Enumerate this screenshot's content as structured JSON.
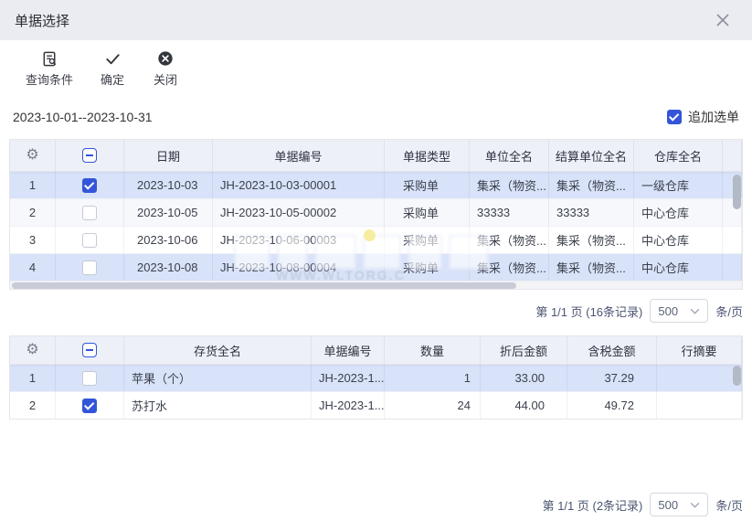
{
  "dialog": {
    "title": "单据选择"
  },
  "toolbar": {
    "query_label": "查询条件",
    "confirm_label": "确定",
    "close_label": "关闭"
  },
  "filter": {
    "date_range": "2023-10-01--2023-10-31",
    "append_label": "追加选单",
    "append_checked": true
  },
  "colors": {
    "accent_blue": "#3355d8",
    "selected_row": "#d8e2f8",
    "header_bg": "#eef0f7",
    "titlebar_bg": "#ebecf1",
    "marker_yellow": "#f6eda0"
  },
  "doc_table": {
    "headers": {
      "date": "日期",
      "doc_no": "单据编号",
      "doc_type": "单据类型",
      "unit": "单位全名",
      "settle_unit": "结算单位全名",
      "warehouse": "仓库全名"
    },
    "header_check": {
      "state": "indeterminate"
    },
    "rows": [
      {
        "num": "1",
        "checked": true,
        "date": "2023-10-03",
        "doc_no": "JH-2023-10-03-00001",
        "doc_type": "采购单",
        "unit": "集采（物资...",
        "settle_unit": "集采（物资...",
        "warehouse": "一级仓库"
      },
      {
        "num": "2",
        "checked": false,
        "date": "2023-10-05",
        "doc_no": "JH-2023-10-05-00002",
        "doc_type": "采购单",
        "unit": "33333",
        "settle_unit": "33333",
        "warehouse": "中心仓库"
      },
      {
        "num": "3",
        "checked": false,
        "date": "2023-10-06",
        "doc_no": "JH-2023-10-06-00003",
        "doc_type": "采购单",
        "unit": "集采（物资...",
        "settle_unit": "集采（物资...",
        "warehouse": "中心仓库"
      },
      {
        "num": "4",
        "checked": false,
        "date": "2023-10-08",
        "doc_no": "JH-2023-10-08-00004",
        "doc_type": "采购单",
        "unit": "集采（物资...",
        "settle_unit": "集采（物资...",
        "warehouse": "中心仓库"
      }
    ]
  },
  "doc_pagination": {
    "page_info": "第 1/1 页 (16条记录)",
    "page_size": "500",
    "unit_label": "条/页"
  },
  "item_table": {
    "headers": {
      "item_name": "存货全名",
      "doc_no": "单据编号",
      "qty": "数量",
      "discount_amount": "折后金额",
      "tax_amount": "含税金额",
      "row_summary": "行摘要"
    },
    "header_check": {
      "state": "indeterminate"
    },
    "rows": [
      {
        "num": "1",
        "checked": false,
        "item_name": "苹果（个）",
        "doc_no": "JH-2023-1...",
        "qty": "1",
        "discount_amount": "33.00",
        "tax_amount": "37.29",
        "row_summary": ""
      },
      {
        "num": "2",
        "checked": true,
        "item_name": "苏打水",
        "doc_no": "JH-2023-1...",
        "qty": "24",
        "discount_amount": "44.00",
        "tax_amount": "49.72",
        "row_summary": ""
      }
    ]
  },
  "item_pagination": {
    "page_info": "第 1/1 页 (2条记录)",
    "page_size": "500",
    "unit_label": "条/页"
  },
  "watermark": {
    "url_text": "WWW.WLTORG.C"
  }
}
